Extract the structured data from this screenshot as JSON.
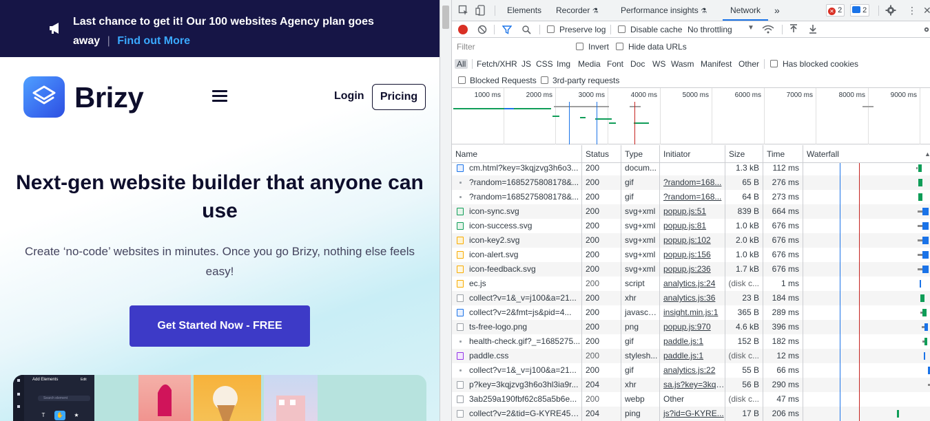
{
  "browser_page": {
    "banner": {
      "text": "Last chance to get it! Our 100 websites Agency plan goes away",
      "separator": "|",
      "link": "Find out More"
    },
    "brand_name": "Brizy",
    "nav": {
      "login": "Login",
      "pricing": "Pricing"
    },
    "hero": {
      "title": "Next-gen website builder that anyone can use",
      "subtitle": "Create ‘no-code’ websites in minutes. Once you go Brizy, nothing else feels easy!",
      "cta": "Get Started Now - FREE"
    },
    "preview": {
      "panel_title": "Add Elements",
      "panel_edit": "Edit",
      "search_placeholder": "Search element",
      "tools": [
        "T",
        "✋",
        "★"
      ]
    }
  },
  "devtools": {
    "tabs": [
      "Elements",
      "Recorder",
      "Performance insights",
      "Network"
    ],
    "active_tab": "Network",
    "more_tabs": "»",
    "error_count": "2",
    "message_count": "2",
    "toolbar": {
      "preserve_log": "Preserve log",
      "disable_cache": "Disable cache",
      "throttling": "No throttling"
    },
    "filter": {
      "placeholder": "Filter",
      "invert": "Invert",
      "hide_data_urls": "Hide data URLs",
      "types": [
        "All",
        "Fetch/XHR",
        "JS",
        "CSS",
        "Img",
        "Media",
        "Font",
        "Doc",
        "WS",
        "Wasm",
        "Manifest",
        "Other"
      ],
      "active_type": "All",
      "has_blocked_cookies": "Has blocked cookies",
      "blocked_requests": "Blocked Requests",
      "third_party": "3rd-party requests"
    },
    "overview_ticks": [
      "1000 ms",
      "2000 ms",
      "3000 ms",
      "4000 ms",
      "5000 ms",
      "6000 ms",
      "7000 ms",
      "8000 ms",
      "9000 ms"
    ],
    "columns": [
      "Name",
      "Status",
      "Type",
      "Initiator",
      "Size",
      "Time",
      "Waterfall"
    ],
    "rows": [
      {
        "name": "cm.html?key=3kqjzvg3h6o3...",
        "status": "200",
        "type": "docum...",
        "initiator": "",
        "size": "1.3 kB",
        "time": "112 ms",
        "icon": "doc-icon",
        "link": false
      },
      {
        "name": "?random=1685275808178&...",
        "status": "200",
        "type": "gif",
        "initiator": "?random=168...",
        "size": "65 B",
        "time": "276 ms",
        "icon": "dot-icon",
        "link": true
      },
      {
        "name": "?random=1685275808178&...",
        "status": "200",
        "type": "gif",
        "initiator": "?random=168...",
        "size": "64 B",
        "time": "273 ms",
        "icon": "dot-icon",
        "link": true
      },
      {
        "name": "icon-sync.svg",
        "status": "200",
        "type": "svg+xml",
        "initiator": "popup.js:51",
        "size": "839 B",
        "time": "664 ms",
        "icon": "image-icon",
        "link": true
      },
      {
        "name": "icon-success.svg",
        "status": "200",
        "type": "svg+xml",
        "initiator": "popup.js:81",
        "size": "1.0 kB",
        "time": "676 ms",
        "icon": "image-icon",
        "link": true
      },
      {
        "name": "icon-key2.svg",
        "status": "200",
        "type": "svg+xml",
        "initiator": "popup.js:102",
        "size": "2.0 kB",
        "time": "676 ms",
        "icon": "key-icon",
        "link": true
      },
      {
        "name": "icon-alert.svg",
        "status": "200",
        "type": "svg+xml",
        "initiator": "popup.js:156",
        "size": "1.0 kB",
        "time": "676 ms",
        "icon": "alert-icon",
        "link": true
      },
      {
        "name": "icon-feedback.svg",
        "status": "200",
        "type": "svg+xml",
        "initiator": "popup.js:236",
        "size": "1.7 kB",
        "time": "676 ms",
        "icon": "feedback-icon",
        "link": true
      },
      {
        "name": "ec.js",
        "status": "200",
        "type": "script",
        "initiator": "analytics.js:24",
        "size": "(disk c...",
        "time": "1 ms",
        "icon": "script-icon",
        "link": true,
        "grey": true
      },
      {
        "name": "collect?v=1&_v=j100&a=21...",
        "status": "200",
        "type": "xhr",
        "initiator": "analytics.js:36",
        "size": "23 B",
        "time": "184 ms",
        "icon": "blank-icon",
        "link": true
      },
      {
        "name": "collect?v=2&fmt=js&pid=4...",
        "status": "200",
        "type": "javascri...",
        "initiator": "insight.min.js:1",
        "size": "365 B",
        "time": "289 ms",
        "icon": "js-file-icon",
        "link": true
      },
      {
        "name": "ts-free-logo.png",
        "status": "200",
        "type": "png",
        "initiator": "popup.js:970",
        "size": "4.6 kB",
        "time": "396 ms",
        "icon": "blank-icon",
        "link": true
      },
      {
        "name": "health-check.gif?_=1685275...",
        "status": "200",
        "type": "gif",
        "initiator": "paddle.js:1",
        "size": "152 B",
        "time": "182 ms",
        "icon": "dot-icon",
        "link": true
      },
      {
        "name": "paddle.css",
        "status": "200",
        "type": "stylesh...",
        "initiator": "paddle.js:1",
        "size": "(disk c...",
        "time": "12 ms",
        "icon": "css-icon",
        "link": true,
        "grey": true
      },
      {
        "name": "collect?v=1&_v=j100&a=21...",
        "status": "200",
        "type": "gif",
        "initiator": "analytics.js:22",
        "size": "55 B",
        "time": "66 ms",
        "icon": "dot-icon",
        "link": true
      },
      {
        "name": "p?key=3kqjzvg3h6o3hl3ia9r...",
        "status": "204",
        "type": "xhr",
        "initiator": "sa.js?key=3kqj...",
        "size": "56 B",
        "time": "290 ms",
        "icon": "blank-icon",
        "link": true
      },
      {
        "name": "3ab259a190fbf62c85a5b6e...",
        "status": "200",
        "type": "webp",
        "initiator": "Other",
        "size": "(disk c...",
        "time": "47 ms",
        "icon": "blank-icon",
        "link": false,
        "grey": true
      },
      {
        "name": "collect?v=2&tid=G-KYRE45J...",
        "status": "204",
        "type": "ping",
        "initiator": "js?id=G-KYRE...",
        "size": "17 B",
        "time": "206 ms",
        "icon": "blank-icon",
        "link": true
      }
    ],
    "colors": {
      "accent": "#1a73e8",
      "dom_loaded": "#1a73e8",
      "load": "#c5221f",
      "bar_green": "#0f9d58",
      "bar_blue": "#1a73e8"
    }
  }
}
